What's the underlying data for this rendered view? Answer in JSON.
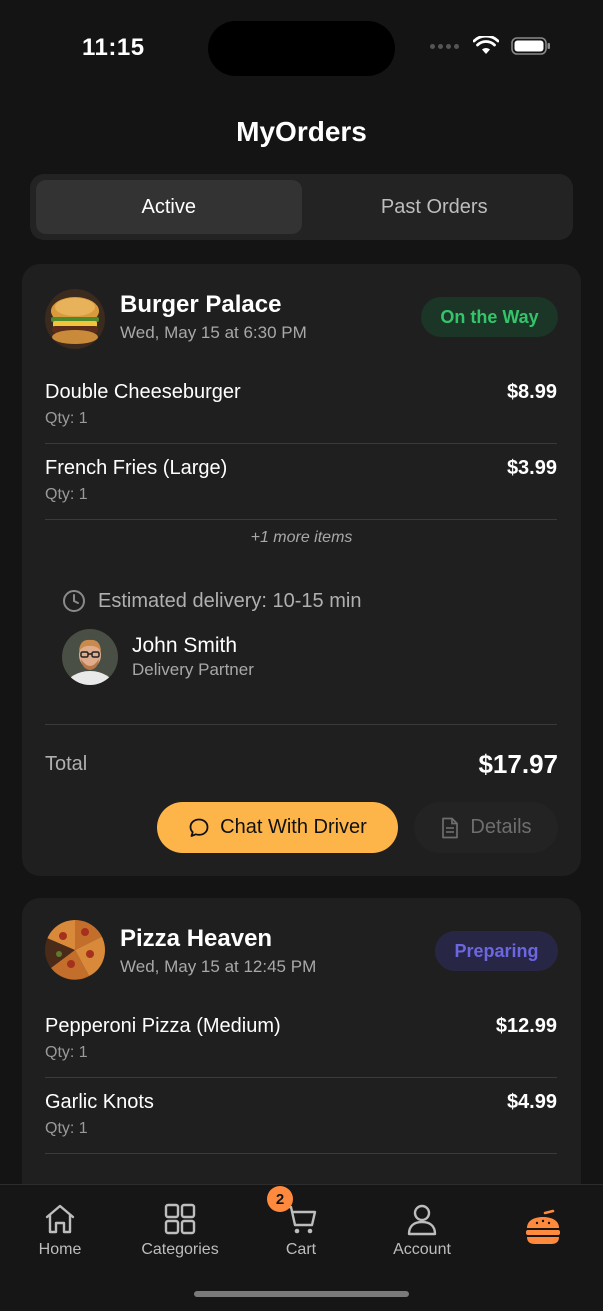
{
  "status_bar": {
    "time": "11:15"
  },
  "page_title": "MyOrders",
  "tabs": [
    {
      "label": "Active",
      "selected": true
    },
    {
      "label": "Past Orders",
      "selected": false
    }
  ],
  "orders": [
    {
      "restaurant": "Burger Palace",
      "datetime": "Wed, May 15 at 6:30 PM",
      "status": "On the Way",
      "status_color": "#34c46a",
      "items": [
        {
          "name": "Double Cheeseburger",
          "qty": "Qty: 1",
          "price": "$8.99"
        },
        {
          "name": "French Fries (Large)",
          "qty": "Qty: 1",
          "price": "$3.99"
        }
      ],
      "more_items": "+1 more items",
      "eta": "Estimated delivery: 10-15 min",
      "driver": {
        "name": "John Smith",
        "role": "Delivery Partner"
      },
      "total_label": "Total",
      "total": "$17.97",
      "chat_label": "Chat With Driver",
      "details_label": "Details"
    },
    {
      "restaurant": "Pizza Heaven",
      "datetime": "Wed, May 15 at 12:45 PM",
      "status": "Preparing",
      "status_color": "#6c66e0",
      "items": [
        {
          "name": "Pepperoni Pizza (Medium)",
          "qty": "Qty: 1",
          "price": "$12.99"
        },
        {
          "name": "Garlic Knots",
          "qty": "Qty: 1",
          "price": "$4.99"
        }
      ]
    }
  ],
  "tab_bar": {
    "items": [
      {
        "label": "Home",
        "icon": "home-icon"
      },
      {
        "label": "Categories",
        "icon": "grid-icon"
      },
      {
        "label": "Cart",
        "icon": "cart-icon",
        "badge": "2"
      },
      {
        "label": "Account",
        "icon": "user-icon"
      },
      {
        "label": "",
        "icon": "food-app-logo-icon"
      }
    ]
  },
  "accent_color": "#fdb54a"
}
